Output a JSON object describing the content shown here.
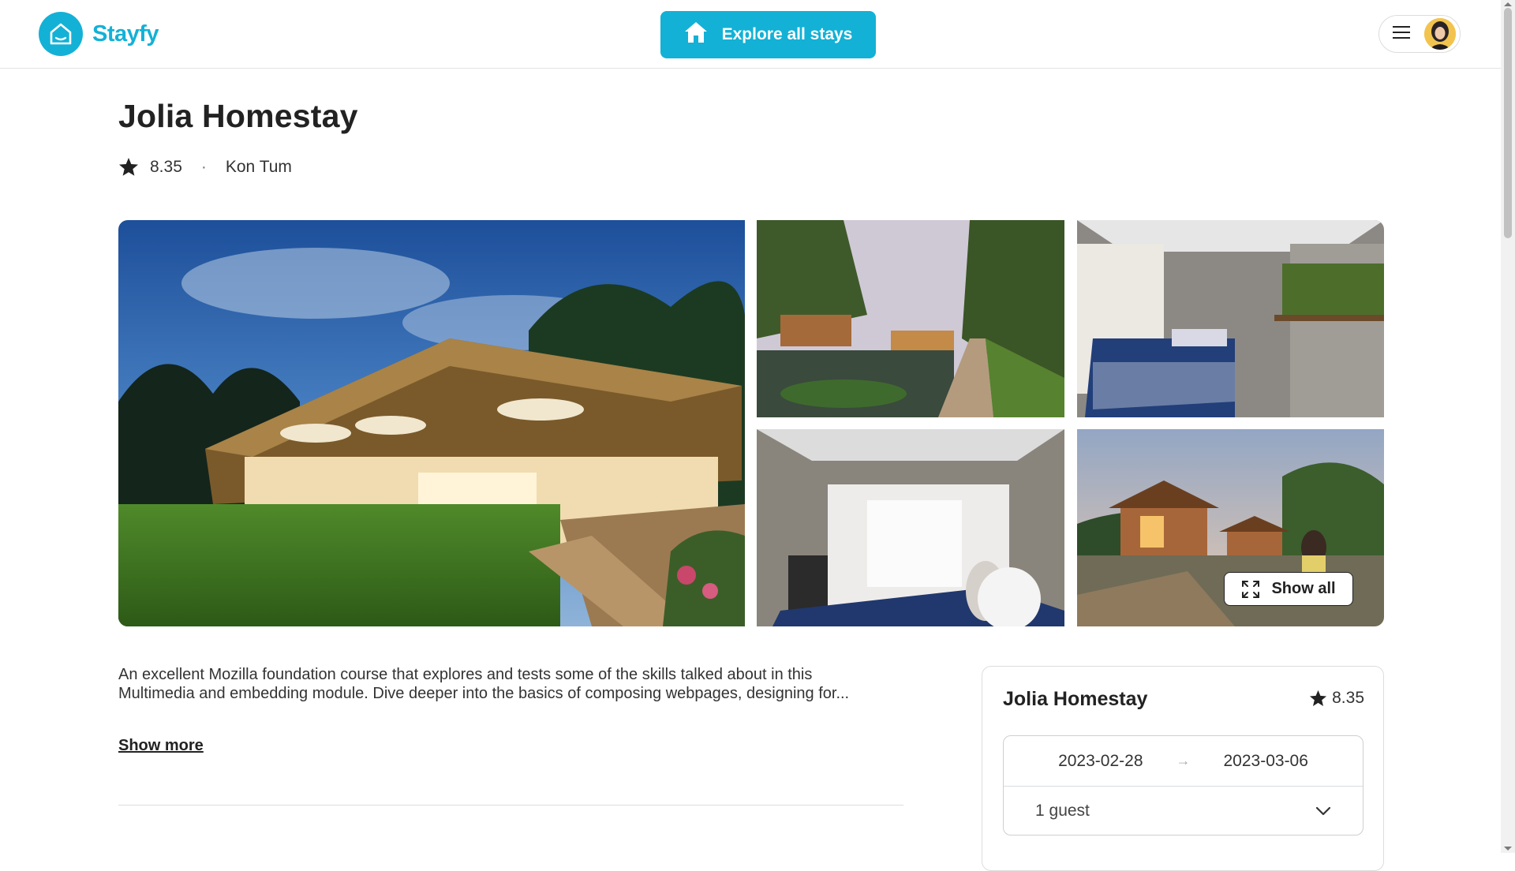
{
  "header": {
    "brand": "Stayfy",
    "explore_label": "Explore all stays"
  },
  "listing": {
    "title": "Jolia Homestay",
    "rating": "8.35",
    "separator": "·",
    "location": "Kon Tum",
    "show_all_label": "Show all",
    "description": "An excellent Mozilla foundation course that explores and tests some of the skills talked about in this Multimedia and embedding module. Dive deeper into the basics of composing webpages, designing for...",
    "show_more_label": "Show more"
  },
  "booking": {
    "title": "Jolia Homestay",
    "rating": "8.35",
    "check_in": "2023-02-28",
    "check_out": "2023-03-06",
    "arrow": "→",
    "guests": "1 guest"
  },
  "icons": {
    "logo": "house-outline-icon",
    "explore": "home-icon",
    "menu": "hamburger-menu-icon",
    "rating": "star-icon",
    "show_all": "expand-icon",
    "guests_dropdown": "chevron-down-icon"
  },
  "colors": {
    "brand": "#14b1d6",
    "text": "#222222"
  }
}
